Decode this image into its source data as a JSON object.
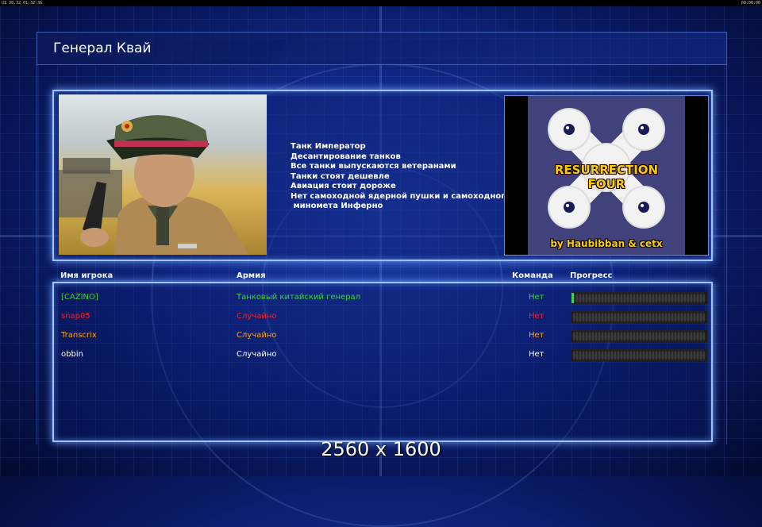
{
  "topbar": {
    "left": "UI 30.32 01:32:36",
    "right": "00:00:00"
  },
  "general": {
    "name": "Генерал Квай",
    "features": [
      "Танк Император",
      "Десантирование танков",
      "Все танки выпускаются ветеранами",
      "Танки стоят дешевле",
      "Авиация стоит дороже",
      "Нет самоходной ядерной пушки и самоходного",
      " минометa Инферно"
    ]
  },
  "map": {
    "title_line1": "RESURRECTION",
    "title_line2": "FOUR",
    "author": "by Haubibban & cetx"
  },
  "columns": {
    "player": "Имя игрока",
    "army": "Армия",
    "team": "Команда",
    "progress": "Прогресс"
  },
  "players": [
    {
      "name": "[CAZINO]",
      "army": "Танковый китайский генерал",
      "team": "Нет",
      "color": "#3fcf3f",
      "progress": 0.015
    },
    {
      "name": "snap05",
      "army": "Случайно",
      "team": "Нет",
      "color": "#ff2020",
      "progress": 0
    },
    {
      "name": "Transcrix",
      "army": "Случайно",
      "team": "Нет",
      "color": "#ffa020",
      "progress": 0
    },
    {
      "name": "obbin",
      "army": "Случайно",
      "team": "Нет",
      "color": "#ffffff",
      "progress": 0
    }
  ],
  "watermark": "2560 x 1600",
  "colors": {
    "panel_border": "#9ec4ff",
    "background": "#0f2580",
    "map_title": "#ffcc00"
  }
}
